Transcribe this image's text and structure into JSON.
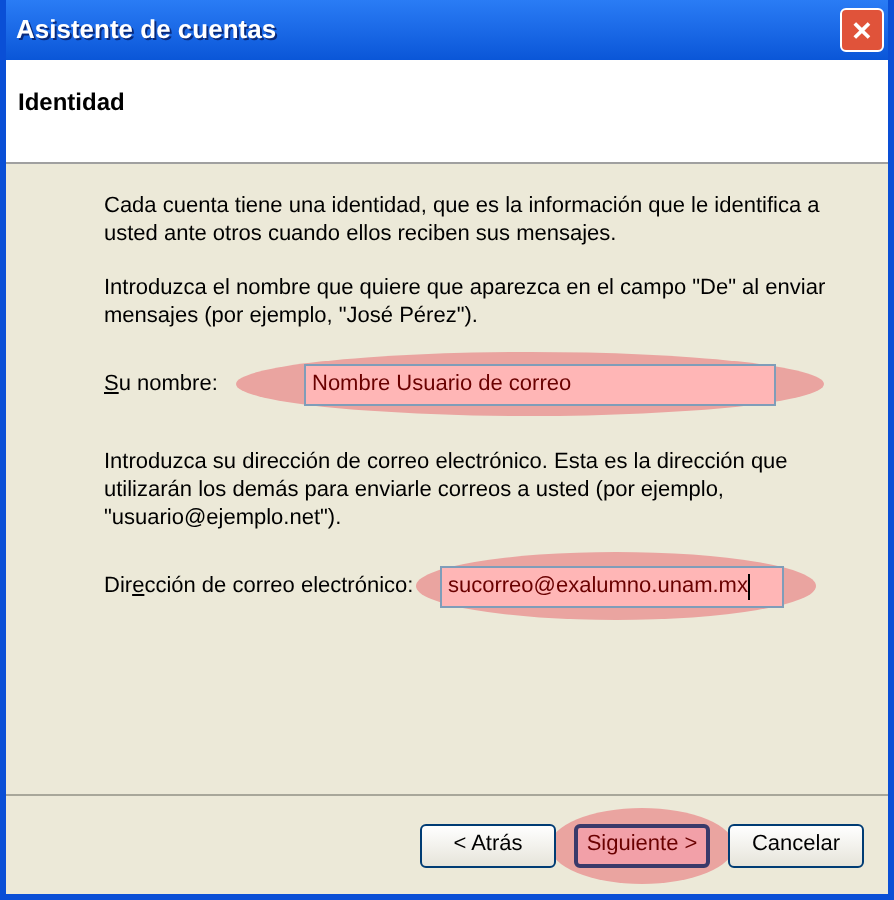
{
  "window": {
    "title": "Asistente de cuentas",
    "close": "✕"
  },
  "header": {
    "title": "Identidad"
  },
  "intro": "Cada cuenta tiene una identidad, que es la información que le identifica a usted ante otros cuando ellos reciben sus mensajes.",
  "fields": [
    {
      "description": "Introduzca el nombre que quiere que aparezca en el campo \"De\" al enviar mensajes (por ejemplo, \"José Pérez\").",
      "label": {
        "key": "S",
        "after": "u nombre:"
      },
      "value": "Nombre Usuario de correo",
      "highlighted": true,
      "focused": false
    },
    {
      "description": "Introduzca su dirección de correo electrónico. Esta es la dirección que utilizarán los demás para enviarle correos a usted (por ejemplo, \"usuario@ejemplo.net\").",
      "label": {
        "before": "Dir",
        "key": "e",
        "after": "cción de correo electrónico:"
      },
      "value": "sucorreo@exalumno.unam.mx",
      "highlighted": true,
      "focused": true
    }
  ],
  "buttons": [
    {
      "label": "< Atrás",
      "highlighted": false
    },
    {
      "label": "Siguiente >",
      "highlighted": true
    },
    {
      "label": "Cancelar",
      "highlighted": false
    }
  ]
}
